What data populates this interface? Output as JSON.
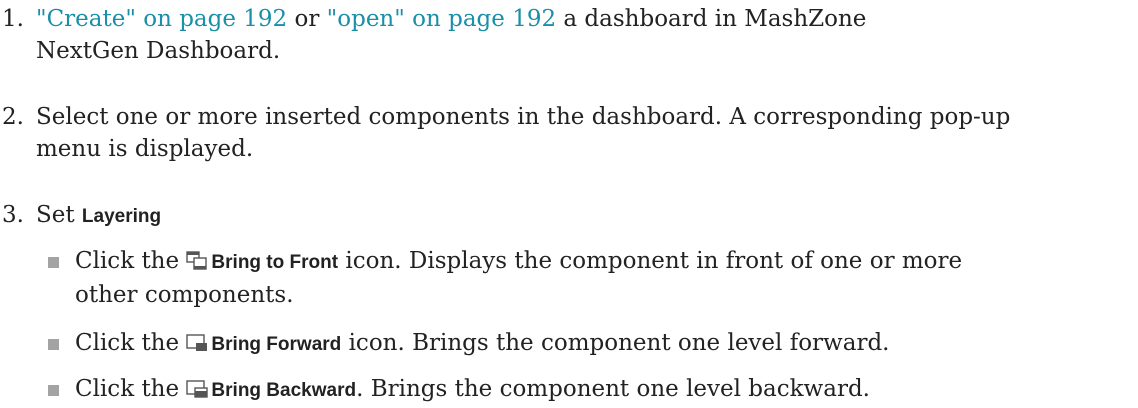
{
  "steps": [
    {
      "number": "1.",
      "link_create": "\"Create\" on page 192",
      "or_text": " or ",
      "link_open": "\"open\" on page 192",
      "rest_line1": " a dashboard in MashZone",
      "rest_line2": "NextGen Dashboard."
    },
    {
      "number": "2.",
      "line1": "Select one or more inserted components in the dashboard. A corresponding pop-up",
      "line2": "menu is displayed."
    },
    {
      "number": "3.",
      "prefix": "Set ",
      "bold": "Layering"
    }
  ],
  "bullets": [
    {
      "icon": "bring-to-front-icon",
      "click": "Click the ",
      "bold": "Bring to Front",
      "rest_line1": " icon. Displays the component in front of one or more",
      "rest_line2": "other components."
    },
    {
      "icon": "bring-forward-icon",
      "click": "Click the ",
      "bold": "Bring Forward",
      "rest": " icon. Brings the component one level forward."
    },
    {
      "icon": "bring-backward-icon",
      "click": "Click the ",
      "bold": "Bring Backward",
      "rest": ". Brings the component one level backward."
    }
  ],
  "colors": {
    "link": "#1a8fa8",
    "text": "#222222",
    "bullet": "#a3a3a3"
  }
}
